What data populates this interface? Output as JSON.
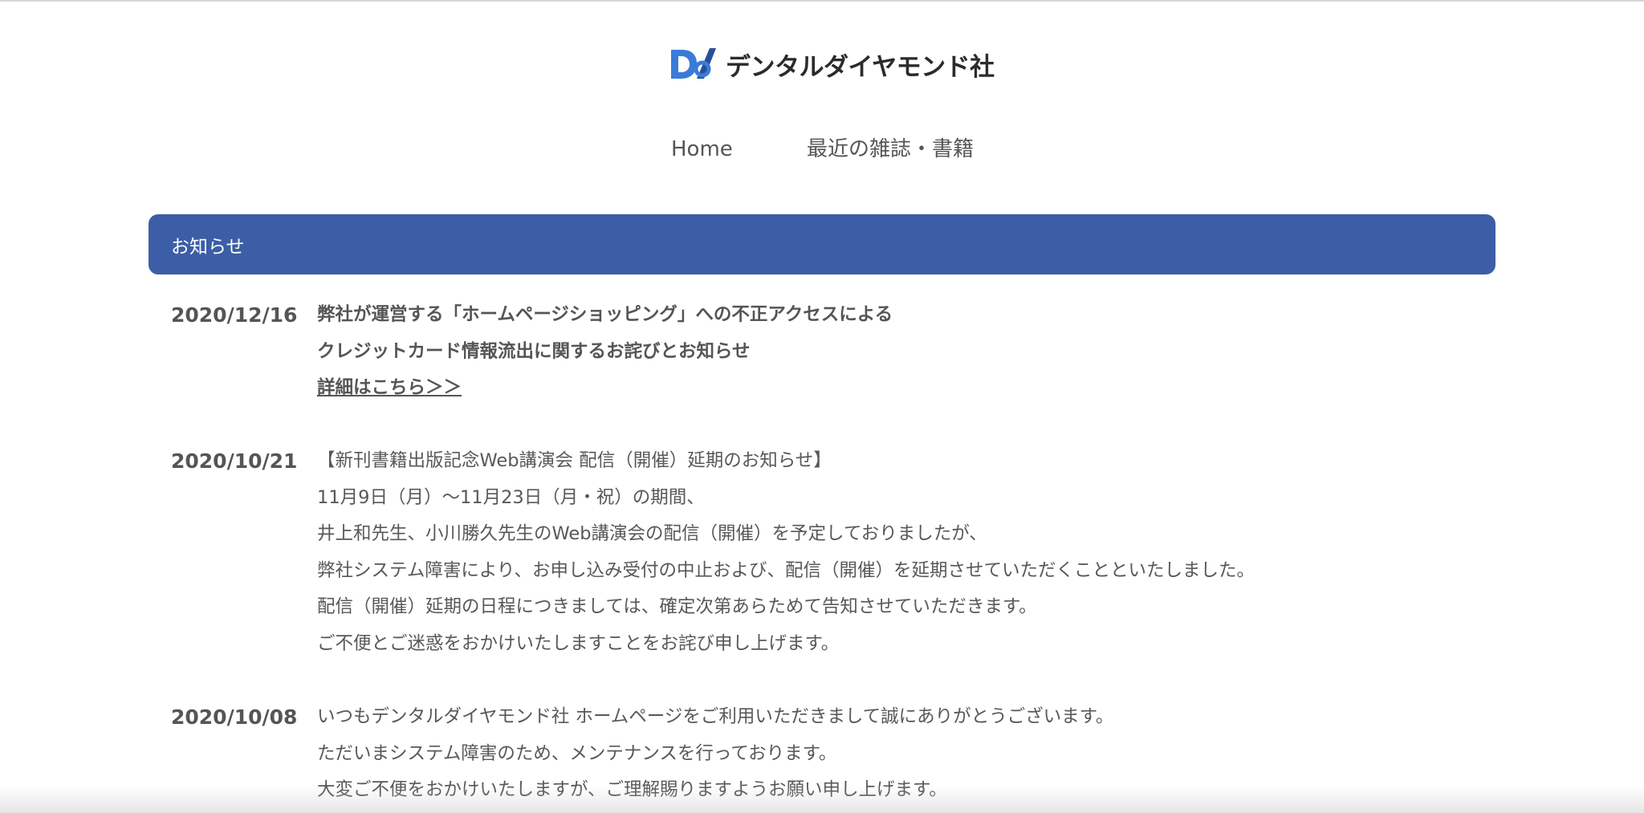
{
  "header": {
    "logo_text": "デンタルダイヤモンド社",
    "nav": [
      {
        "label": "Home"
      },
      {
        "label": "最近の雑誌・書籍"
      }
    ]
  },
  "notices": {
    "title": "お知らせ",
    "items": [
      {
        "date": "2020/12/16",
        "lines": [
          "弊社が運営する「ホームページショッピング」への不正アクセスによる",
          "クレジットカード情報流出に関するお詫びとお知らせ"
        ],
        "link": "詳細はこちら＞＞"
      },
      {
        "date": "2020/10/21",
        "lines": [
          "【新刊書籍出版記念Web講演会 配信（開催）延期のお知らせ】",
          "11月9日（月）〜11月23日（月・祝）の期間、",
          "井上和先生、小川勝久先生のWeb講演会の配信（開催）を予定しておりましたが、",
          "弊社システム障害により、お申し込み受付の中止および、配信（開催）を延期させていただくことといたしました。",
          "配信（開催）延期の日程につきましては、確定次第あらためて告知させていただきます。",
          "ご不便とご迷惑をおかけいたしますことをお詫び申し上げます。"
        ]
      },
      {
        "date": "2020/10/08",
        "lines": [
          "いつもデンタルダイヤモンド社 ホームページをご利用いただきまして誠にありがとうございます。",
          "ただいまシステム障害のため、メンテナンスを行っております。",
          "大変ご不便をおかけいたしますが、ご理解賜りますようお願い申し上げます。"
        ]
      }
    ]
  },
  "colors": {
    "header_bar": "#3c5ea6",
    "logo_blue": "#2f6fd6",
    "text": "#585858"
  }
}
